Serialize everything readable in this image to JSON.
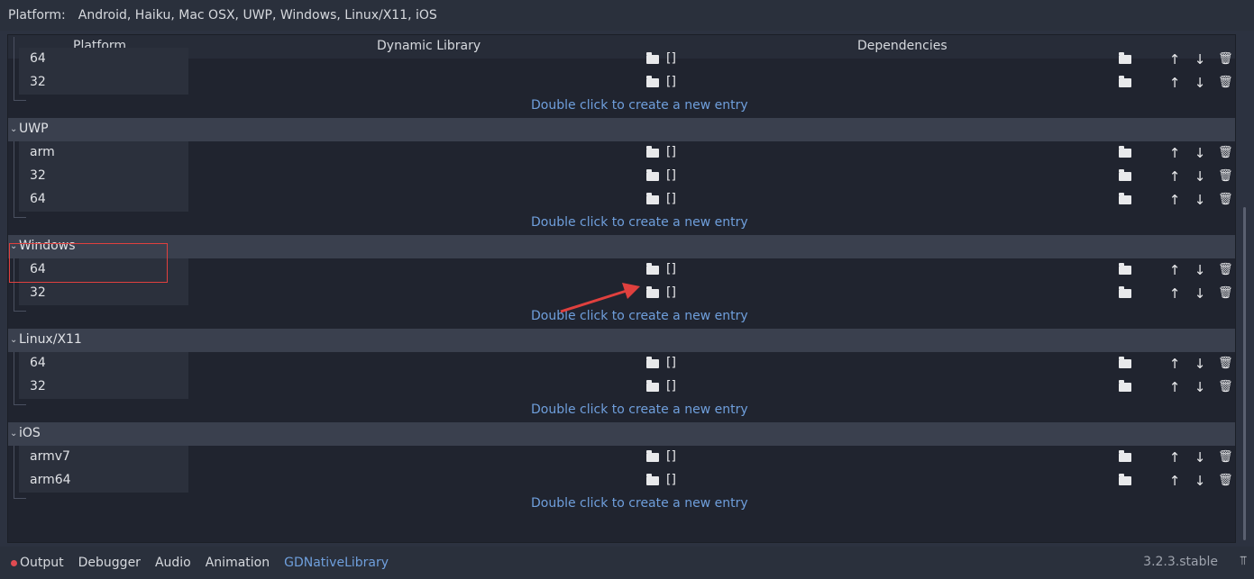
{
  "top": {
    "label": "Platform:",
    "value": "Android, Haiku, Mac OSX, UWP, Windows, Linux/X11, iOS"
  },
  "columns": {
    "platform": "Platform",
    "library": "Dynamic Library",
    "dependencies": "Dependencies"
  },
  "empty_value": "[]",
  "new_entry_text": "Double click to create a new entry",
  "groups": [
    {
      "name": "",
      "items": [
        "64",
        "32"
      ]
    },
    {
      "name": "UWP",
      "items": [
        "arm",
        "32",
        "64"
      ]
    },
    {
      "name": "Windows",
      "items": [
        "64",
        "32"
      ]
    },
    {
      "name": "Linux/X11",
      "items": [
        "64",
        "32"
      ]
    },
    {
      "name": "iOS",
      "items": [
        "armv7",
        "arm64"
      ]
    }
  ],
  "icons": {
    "folder": "folder-icon",
    "up": "move-up-icon",
    "down": "move-down-icon",
    "delete": "trash-icon",
    "collapse": "chevron-down-icon"
  },
  "bottom": {
    "tabs": [
      "Output",
      "Debugger",
      "Audio",
      "Animation",
      "GDNativeLibrary"
    ],
    "active_tab": "GDNativeLibrary",
    "version": "3.2.3.stable"
  },
  "colors": {
    "link": "#6f9fdc",
    "annotation": "#e0403e",
    "output_dot": "#e04b52"
  }
}
